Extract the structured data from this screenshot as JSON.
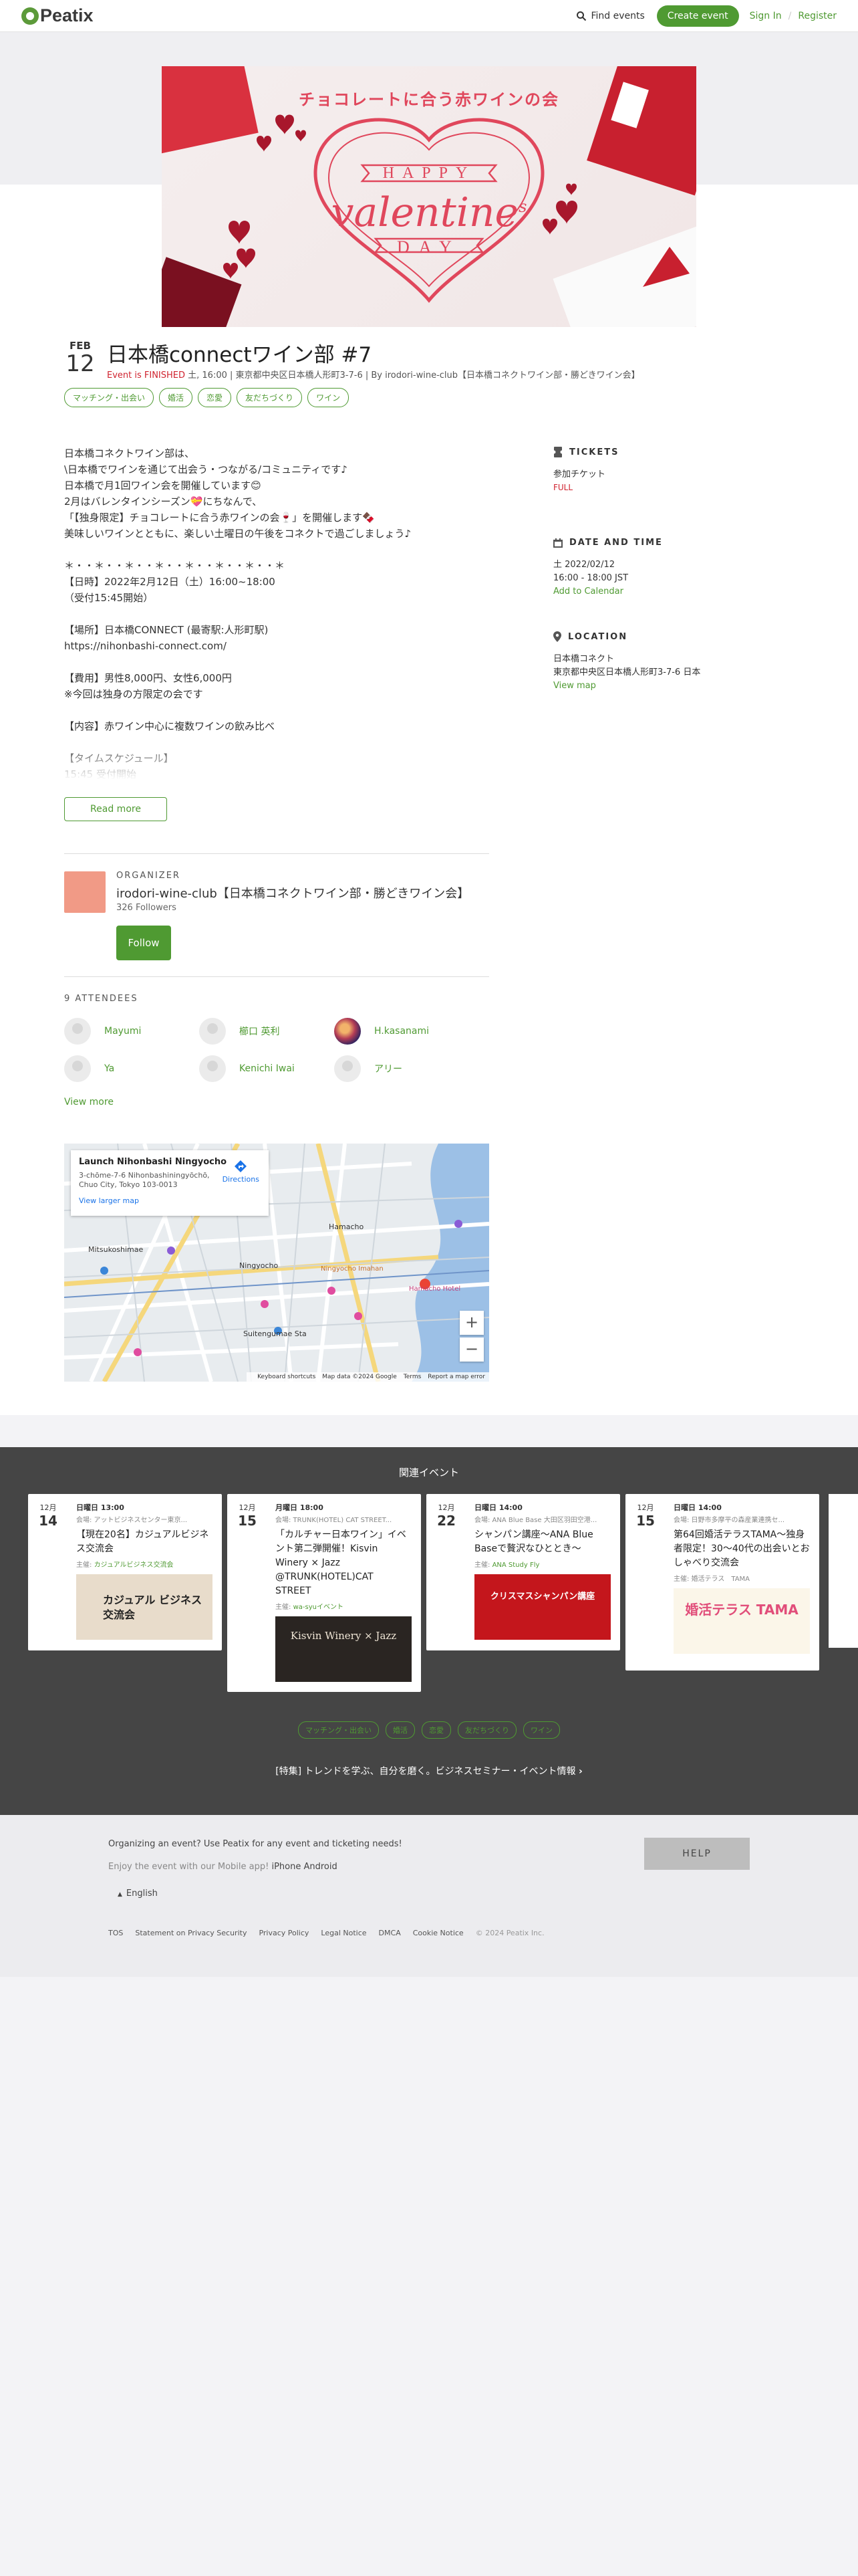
{
  "header": {
    "logo": "Peatix",
    "find_events": "Find events",
    "create_event": "Create event",
    "sign_in": "Sign In",
    "separator": "/",
    "register": "Register"
  },
  "hero": {
    "jp_title": "チョコレートに合う赤ワインの会",
    "word_top": "HAPPY",
    "word_mid": "valentine",
    "word_suffix": "s",
    "word_bot": "DAY"
  },
  "event": {
    "month": "FEB",
    "day": "12",
    "title": "日本橋connectワイン部 #7",
    "status": "Event is FINISHED",
    "meta": " 土, 16:00 | 東京都中央区日本橋人形町3-7-6 | By irodori-wine-club【日本橋コネクトワイン部・勝どきワイン会】",
    "tags": [
      "マッチング・出会い",
      "婚活",
      "恋愛",
      "友だちづくり",
      "ワイン"
    ]
  },
  "description": "日本橋コネクトワイン部は、\n\\日本橋でワインを通じて出会う・つながる/コミュニティです♪\n日本橋で月1回ワイン会を開催しています😊\n2月はバレンタインシーズン💝にちなんで、\n「【独身限定】チョコレートに合う赤ワインの会🍷」を開催します🍫\n美味しいワインとともに、楽しい土曜日の午後をコネクトで過ごしましょう♪\n\n＊・・＊・・＊・・＊・・＊・・＊・・＊・・＊\n【日時】2022年2月12日（土）16:00~18:00\n（受付15:45開始）\n\n【場所】日本橋CONNECT (最寄駅:人形町駅)\nhttps://nihonbashi-connect.com/\n\n【費用】男性8,000円、女性6,000円\n※今回は独身の方限定の会です\n\n【内容】赤ワイン中心に複数ワインの飲み比べ\n\n【タイムスケジュール】\n15:45 受付開始",
  "read_more": "Read more",
  "sidebar": {
    "tickets": {
      "heading": "TICKETS",
      "ticket_name": "参加チケット",
      "ticket_status": "FULL"
    },
    "datetime": {
      "heading": "DATE AND TIME",
      "date": "土 2022/02/12",
      "time": "16:00 - 18:00 JST",
      "add_calendar": "Add to Calendar"
    },
    "location": {
      "heading": "LOCATION",
      "name": "日本橋コネクト",
      "address": "東京都中央区日本橋人形町3-7-6 日本",
      "view_map": "View map"
    }
  },
  "organizer": {
    "label": "ORGANIZER",
    "name": "irodori-wine-club【日本橋コネクトワイン部・勝どきワイン会】",
    "followers": "326 Followers",
    "follow": "Follow"
  },
  "attendees": {
    "heading": "9 ATTENDEES",
    "list": [
      "Mayumi",
      "櫛口 英利",
      "H.kasanami",
      "Ya",
      "Kenichi Iwai",
      "アリー"
    ],
    "view_more": "View more"
  },
  "map": {
    "place": "Launch Nihonbashi Ningyocho",
    "address": "3-chōme-7-6 Nihonbashiningyōchō, Chuo City, Tokyo 103-0013",
    "directions": "Directions",
    "view_larger": "View larger map",
    "zoom_in": "+",
    "zoom_out": "−",
    "footer": [
      "Keyboard shortcuts",
      "Map data ©2024 Google",
      "Terms",
      "Report a map error"
    ],
    "labels": [
      "Mitsukoshimae",
      "Ningyocho",
      "Hamacho",
      "Suitengumae Sta",
      "Hamacho Hotel",
      "Ningyocho Imahan"
    ]
  },
  "related": {
    "title": "関連イベント",
    "cards": [
      {
        "month": "12月",
        "day": "14",
        "when": "日曜日 13:00",
        "venue": "会場: アットビジネスセンター東京...",
        "title": "【現在20名】カジュアルビジネス交流会",
        "host_prefix": "主催: ",
        "host": "カジュアルビジネス交流会",
        "img_text": "カジュアル ビジネス交流会"
      },
      {
        "month": "12月",
        "day": "15",
        "when": "月曜日 18:00",
        "venue": "会場: TRUNK(HOTEL) CAT STREET...",
        "title": "「カルチャー日本ワイン」イベント第二弾開催！Kisvin Winery × Jazz @TRUNK(HOTEL)CAT STREET",
        "host_prefix": "主催: ",
        "host": "wa-syuイベント",
        "img_text": "Kisvin Winery × Jazz"
      },
      {
        "month": "12月",
        "day": "22",
        "when": "日曜日 14:00",
        "venue": "会場: ANA Blue Base 大田区羽田空港...",
        "title": "シャンパン講座〜ANA Blue Baseで贅沢なひととき〜",
        "host_prefix": "主催: ",
        "host": "ANA Study Fly",
        "img_text": "クリスマスシャンパン講座"
      },
      {
        "month": "12月",
        "day": "15",
        "when": "日曜日 14:00",
        "venue": "会場: 日野市多摩平の森産業連携セ...",
        "title": "第64回婚活テラスTAMA〜独身者限定！30〜40代の出会いとおしゃべり交流会",
        "host_prefix": "主催: ",
        "host": "婚活テラス　TAMA",
        "img_text": "婚活テラス TAMA"
      }
    ],
    "tags": [
      "マッチング・出会い",
      "婚活",
      "恋愛",
      "友だちづくり",
      "ワイン"
    ],
    "feature": "[特集] トレンドを学ぶ、自分を磨く。ビジネスセミナー・イベント情報 "
  },
  "footer": {
    "organizing": "Organizing an event? Use Peatix for any event and ticketing needs!",
    "app_prefix": "Enjoy the event with our Mobile app! ",
    "iphone": "iPhone",
    "android": "Android",
    "help": "HELP",
    "language": "English",
    "links": [
      "TOS",
      "Statement on Privacy Security",
      "Privacy Policy",
      "Legal Notice",
      "DMCA",
      "Cookie Notice"
    ],
    "copyright": "© 2024 Peatix Inc."
  },
  "colors": {
    "accent": "#4f9a32",
    "finished": "#d0232f",
    "related_bg": "#454545"
  }
}
